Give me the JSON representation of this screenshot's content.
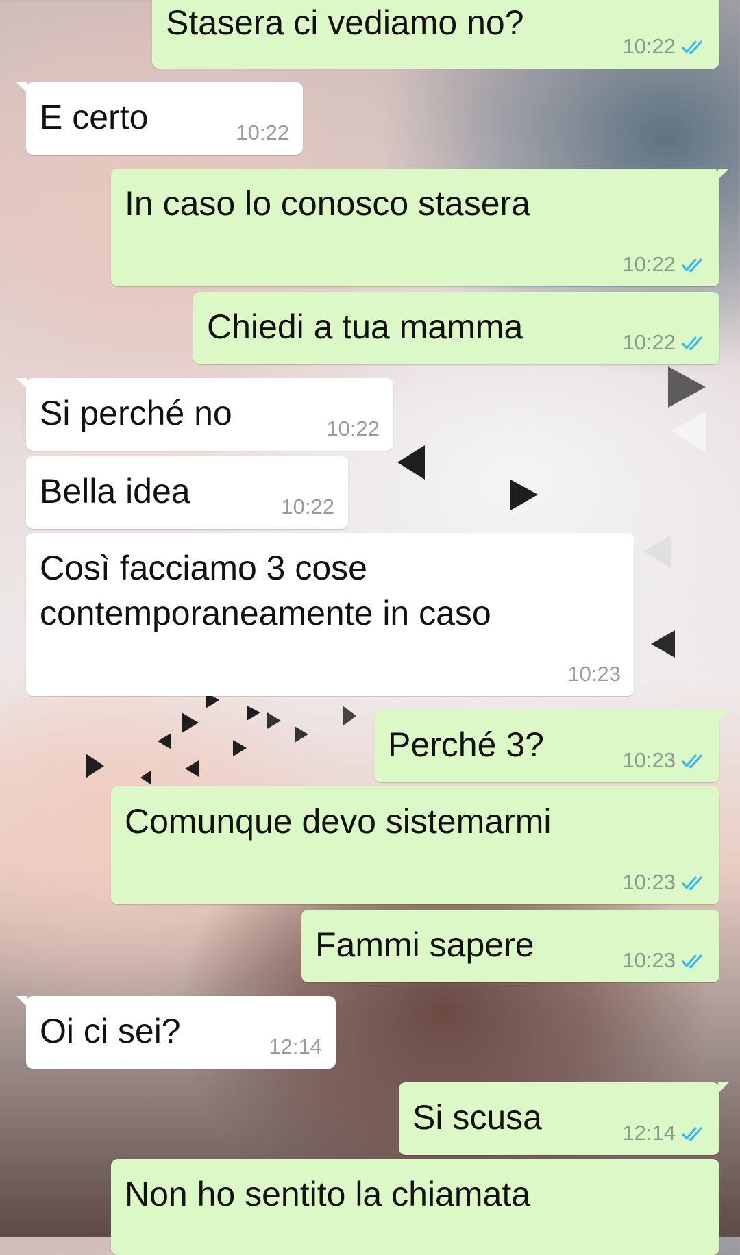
{
  "colors": {
    "outgoing_bubble": "#dcf8c6",
    "incoming_bubble": "#ffffff",
    "read_ticks": "#34b7f1"
  },
  "messages": [
    {
      "dir": "out",
      "text": "Stasera ci vediamo no?",
      "time": "10:22",
      "read": true
    },
    {
      "dir": "in",
      "text": "E certo",
      "time": "10:22"
    },
    {
      "dir": "out",
      "text": "In caso lo conosco stasera",
      "time": "10:22",
      "read": true
    },
    {
      "dir": "out",
      "text": "Chiedi a tua mamma",
      "time": "10:22",
      "read": true
    },
    {
      "dir": "in",
      "text": "Si perché no",
      "time": "10:22"
    },
    {
      "dir": "in",
      "text": "Bella idea",
      "time": "10:22"
    },
    {
      "dir": "in",
      "text": "Così facciamo 3 cose\ncontemporaneamente in caso",
      "time": "10:23"
    },
    {
      "dir": "out",
      "text": "Perché 3?",
      "time": "10:23",
      "read": true
    },
    {
      "dir": "out",
      "text": "Comunque devo sistemarmi",
      "time": "10:23",
      "read": true
    },
    {
      "dir": "out",
      "text": "Fammi sapere",
      "time": "10:23",
      "read": true
    },
    {
      "dir": "in",
      "text": "Oi ci sei?",
      "time": "12:14"
    },
    {
      "dir": "out",
      "text": "Si scusa",
      "time": "12:14",
      "read": true
    },
    {
      "dir": "out",
      "text": "Non ho sentito la chiamata",
      "time": ""
    }
  ]
}
